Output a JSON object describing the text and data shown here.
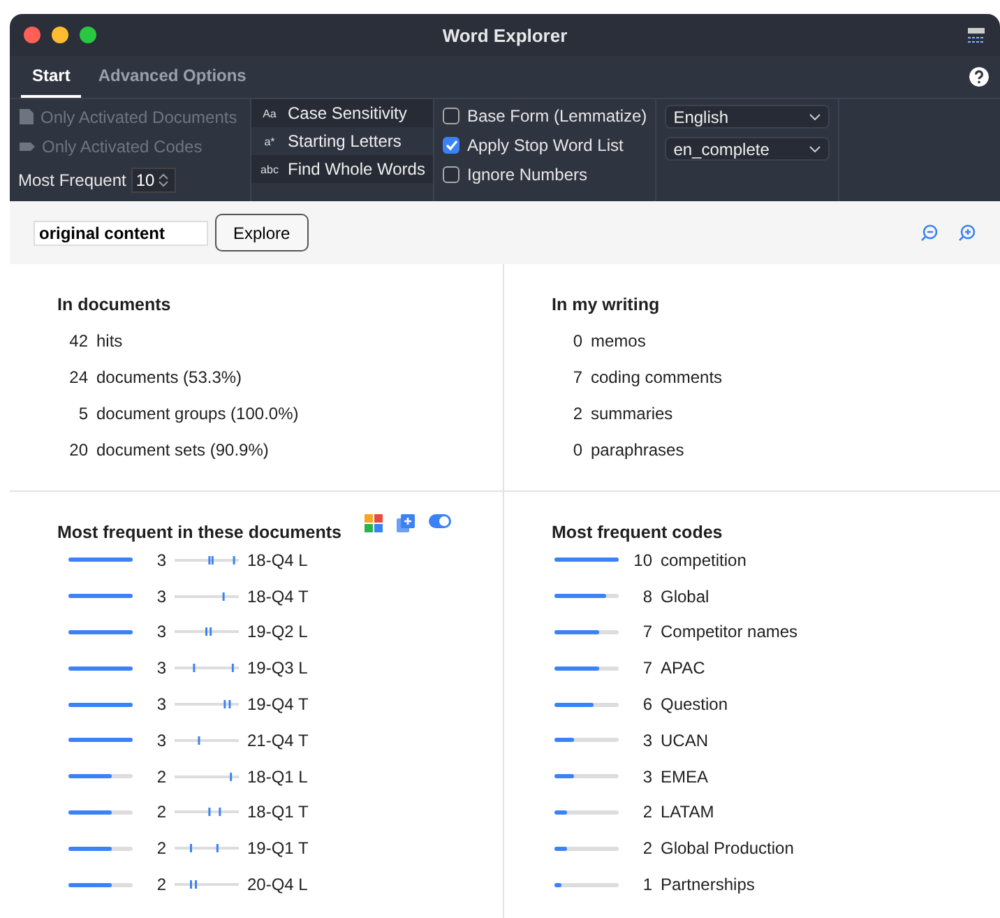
{
  "window": {
    "title": "Word Explorer"
  },
  "tabs": [
    {
      "label": "Start",
      "selected": true
    },
    {
      "label": "Advanced Options",
      "selected": false
    }
  ],
  "filters": [
    {
      "label": "Only Activated Documents",
      "disabled": true,
      "kind": "document"
    },
    {
      "label": "Only Activated Codes",
      "disabled": true,
      "kind": "code"
    }
  ],
  "most_frequent": {
    "label": "Most Frequent",
    "value": "10"
  },
  "match_options": [
    {
      "icon": "Aa",
      "label": "Case Sensitivity",
      "selected": true
    },
    {
      "icon": "a*",
      "label": "Starting Letters",
      "selected": false
    },
    {
      "icon": "abc",
      "label": "Find Whole Words",
      "selected": true
    }
  ],
  "checkboxes": [
    {
      "label": "Base Form (Lemmatize)",
      "checked": false
    },
    {
      "label": "Apply Stop Word List",
      "checked": true
    },
    {
      "label": "Ignore Numbers",
      "checked": false
    }
  ],
  "dropdowns": [
    {
      "value": "English"
    },
    {
      "value": "en_complete"
    }
  ],
  "search": {
    "value": "original content",
    "button": "Explore"
  },
  "in_documents": {
    "title": "In documents",
    "rows": [
      {
        "count": "42",
        "label": "hits"
      },
      {
        "count": "24",
        "label": "documents (53.3%)"
      },
      {
        "count": "5",
        "label": "document groups (100.0%)"
      },
      {
        "count": "20",
        "label": "document sets (90.9%)"
      }
    ]
  },
  "in_my_writing": {
    "title": "In my writing",
    "rows": [
      {
        "count": "0",
        "label": "memos"
      },
      {
        "count": "7",
        "label": "coding comments"
      },
      {
        "count": "2",
        "label": "summaries"
      },
      {
        "count": "0",
        "label": "paraphrases"
      }
    ]
  },
  "most_frequent_documents": {
    "title": "Most frequent in these documents",
    "toggle_on": true,
    "rows": [
      {
        "count": "3",
        "label": "18-Q4 L",
        "level": 1
      },
      {
        "count": "3",
        "label": "18-Q4 T",
        "level": 1
      },
      {
        "count": "3",
        "label": "19-Q2 L",
        "level": 1
      },
      {
        "count": "3",
        "label": "19-Q3 L",
        "level": 1
      },
      {
        "count": "3",
        "label": "19-Q4 T",
        "level": 1
      },
      {
        "count": "3",
        "label": "21-Q4 T",
        "level": 1
      },
      {
        "count": "2",
        "label": "18-Q1 L",
        "level": 0.67
      },
      {
        "count": "2",
        "label": "18-Q1 T",
        "level": 0.67
      },
      {
        "count": "2",
        "label": "19-Q1 T",
        "level": 0.67
      },
      {
        "count": "2",
        "label": "20-Q4 L",
        "level": 0.67
      }
    ]
  },
  "most_frequent_codes": {
    "title": "Most frequent codes",
    "rows": [
      {
        "count": "10",
        "label": "competition",
        "level": 1
      },
      {
        "count": "8",
        "label": "Global",
        "level": 0.8
      },
      {
        "count": "7",
        "label": "Competitor names",
        "level": 0.7
      },
      {
        "count": "7",
        "label": "APAC",
        "level": 0.7
      },
      {
        "count": "6",
        "label": "Question",
        "level": 0.6
      },
      {
        "count": "3",
        "label": "UCAN",
        "level": 0.3
      },
      {
        "count": "3",
        "label": "EMEA",
        "level": 0.3
      },
      {
        "count": "2",
        "label": "LATAM",
        "level": 0.2
      },
      {
        "count": "2",
        "label": "Global Production",
        "level": 0.2
      },
      {
        "count": "1",
        "label": "Partnerships",
        "level": 0.1
      }
    ]
  }
}
